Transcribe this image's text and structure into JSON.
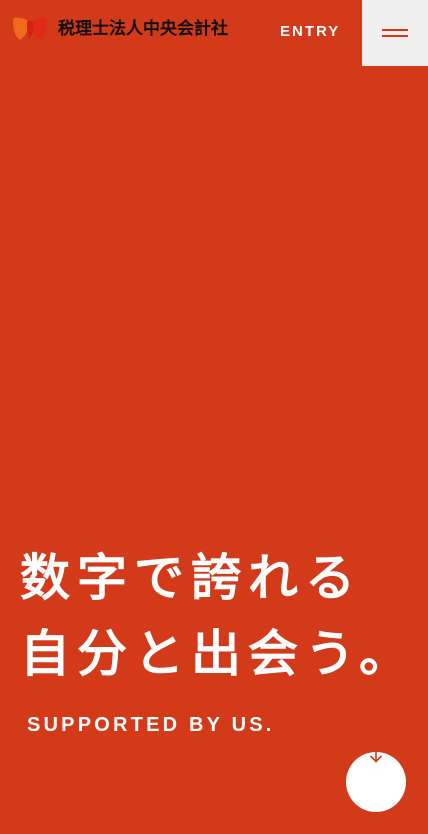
{
  "header": {
    "brand_name": "税理士法人中央会計社",
    "logo_icon": "heart-leaf-logo-icon",
    "entry_label": "ENTRY",
    "menu_icon": "hamburger-menu-icon"
  },
  "hero": {
    "line1": "数字で誇れる",
    "line2": "自分と出会う。",
    "tagline": "SUPPORTED BY US."
  },
  "scroll": {
    "icon": "arrow-down-icon"
  },
  "colors": {
    "background": "#d23a19",
    "menu_bg": "#efefef",
    "text_light": "#ffffff",
    "text_dark": "#111111",
    "logo_orange": "#ef6a1b",
    "logo_red": "#e02a1a"
  }
}
